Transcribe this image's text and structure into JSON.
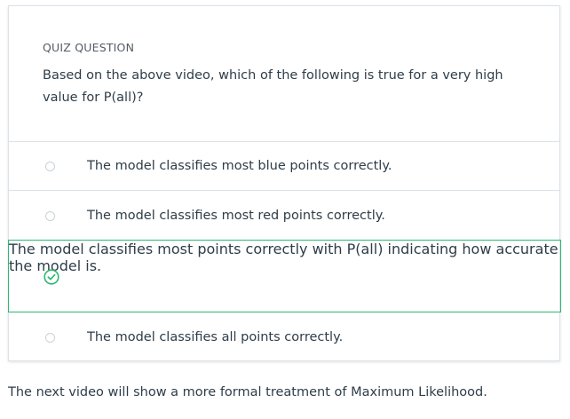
{
  "quiz": {
    "label": "QUIZ QUESTION",
    "question": "Based on the above video, which of the following is true for a very high value for P(all)?",
    "options": [
      {
        "text": "The model classifies most blue points correctly.",
        "selected": false
      },
      {
        "text": "The model classifies most red points correctly.",
        "selected": false
      },
      {
        "text": "The model classifies most points correctly with P(all) indicating how accurate the model is.",
        "selected": true
      },
      {
        "text": "The model classifies all points correctly.",
        "selected": false
      }
    ]
  },
  "footer": {
    "text": "The next video will show a more formal treatment of Maximum Likelihood."
  },
  "colors": {
    "selected_border": "#2eb872",
    "check_icon": "#2eb872",
    "divider": "#dbe2e8",
    "text": "#2e3d49"
  },
  "icons": {
    "selected": "check-circle-icon",
    "unselected": "radio-empty-icon"
  }
}
